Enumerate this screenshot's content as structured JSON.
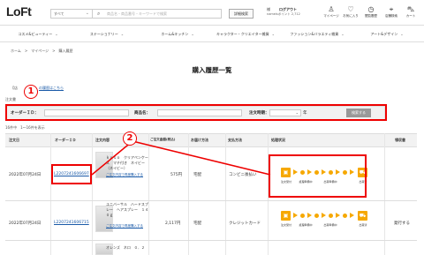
{
  "header": {
    "logo": "LoFt",
    "category_select": "すべて",
    "search_placeholder": "商品名・商品番号・キーワードで検索",
    "detail_search": "詳細検索",
    "user_name": "様",
    "logout": "ログアウト",
    "points": "nameisポイント 2,712",
    "icons": [
      {
        "name": "mypage-icon",
        "glyph": "♙",
        "label": "マイページ"
      },
      {
        "name": "favorite-icon",
        "glyph": "♡",
        "label": "お気に入り"
      },
      {
        "name": "history-icon",
        "glyph": "◷",
        "label": "閲覧履歴"
      },
      {
        "name": "shop-icon",
        "glyph": "⌖",
        "label": "店舗検索"
      },
      {
        "name": "cart-icon",
        "glyph": "⛍",
        "label": "カート"
      }
    ]
  },
  "nav": [
    {
      "label": "コスメ&ビューティー"
    },
    {
      "label": "ステーショナリー"
    },
    {
      "label": "ホーム&キッチン"
    },
    {
      "label": "キャラクター・クリエイター雑貨"
    },
    {
      "label": "ファッション&バラエティ雑貨"
    },
    {
      "label": "アート&デザイン"
    }
  ],
  "breadcrumb": "ホーム　>　マイページ　>　購入履歴",
  "page_title": "購入履歴一覧",
  "note_prefix": "【店",
  "note_link": "の履歴はこちら",
  "note_label": "注文書",
  "search_form": {
    "order_id_label": "オーダーＩＤ：",
    "product_label": "商品名：",
    "date_label": "注文時期：",
    "year_unit": "年",
    "search_button": "検索する"
  },
  "count_text": "16件中　1～16件を表示",
  "table": {
    "headers": [
      "注文日",
      "オーダーＩＤ",
      "注文内容",
      "ご注文金額(税込)",
      "お届け方法",
      "支払方法",
      "処理状況",
      "領収書"
    ],
    "rows": [
      {
        "date": "2022年07月24日",
        "order_id": "L2207241606697",
        "product": "ｋａｓｏ　クリアペンケース　マチ付き　ネイビー　（ネイビー）",
        "detail_link": "ご注文内容で再度購入する",
        "amount": "575円",
        "delivery": "宅配",
        "payment": "コンビニ後払い",
        "receipt": ""
      },
      {
        "date": "2022年07月24日",
        "order_id": "L2207241606715",
        "product": "ユニバーサル　ハードスプレー　ヘアスプレー　１４０ｇ",
        "detail_link": "ご注文内容で再度購入する",
        "amount": "2,117円",
        "delivery": "宅配",
        "payment": "クレジットカード",
        "receipt": "発行する"
      },
      {
        "product": "オレンズ　ネロ　０．２"
      }
    ]
  },
  "progress_steps": [
    "注文受付",
    "処理準備中",
    "出荷準備中",
    "出荷済"
  ],
  "annotations": [
    "1",
    "2"
  ],
  "colors": {
    "progress": "#f6a800",
    "annotation": "#e00000",
    "link": "#1a5aa8"
  }
}
